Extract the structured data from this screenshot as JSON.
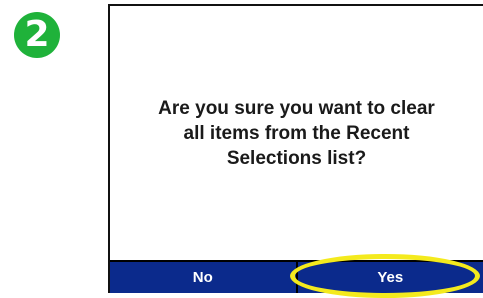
{
  "step": {
    "number": "2",
    "color": "#1fb23a"
  },
  "dialog": {
    "message_line1": "Are you sure you want to clear",
    "message_line2": "all items from the Recent",
    "message_line3": "Selections list?"
  },
  "buttons": {
    "no_label": "No",
    "yes_label": "Yes"
  },
  "highlight": {
    "target": "yes-button",
    "color": "#f4ea1d"
  },
  "colors": {
    "button_bar": "#0b2a8c"
  }
}
